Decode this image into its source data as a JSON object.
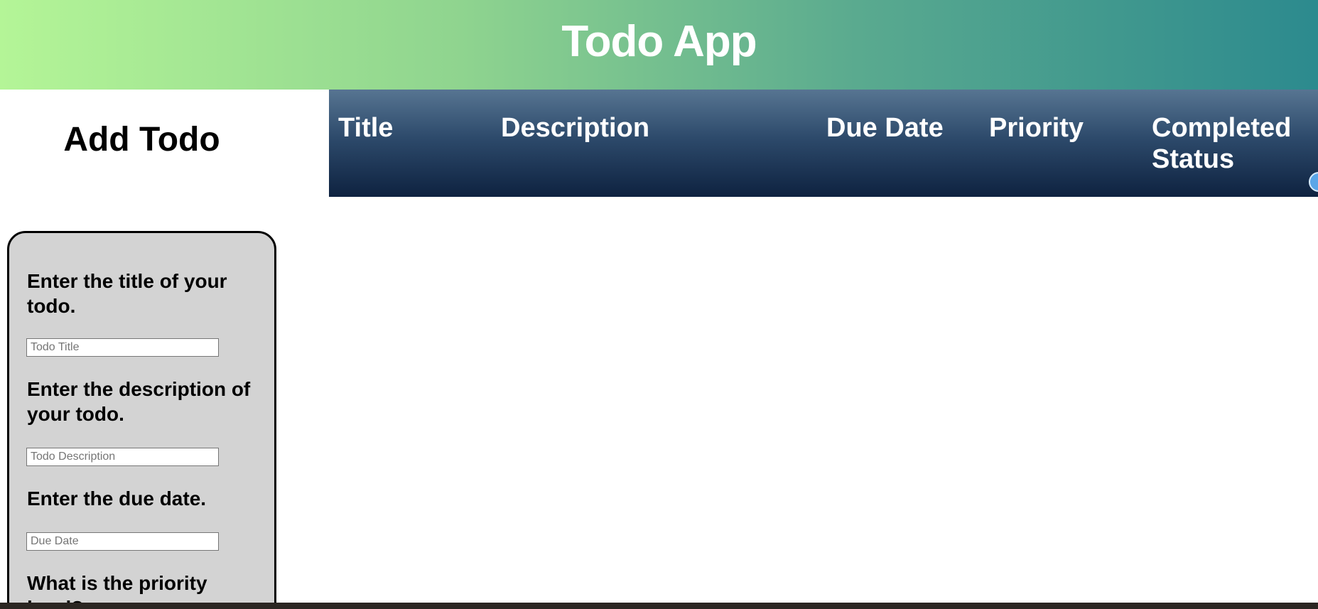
{
  "header": {
    "app_title": "Todo App"
  },
  "add_panel": {
    "heading": "Add Todo"
  },
  "table": {
    "columns": [
      "Title",
      "Description",
      "Due Date",
      "Priority",
      "Completed Status"
    ]
  },
  "form": {
    "title_label": "Enter the title of your todo.",
    "title_placeholder": "Todo Title",
    "description_label": "Enter the description of your todo.",
    "description_placeholder": "Todo Description",
    "due_label": "Enter the due date.",
    "due_placeholder": "Due Date",
    "priority_label": "What is the priority level?"
  },
  "colors": {
    "header_gradient_start": "#b4f597",
    "header_gradient_end": "#2c8a8e",
    "table_header_top": "#577592",
    "table_header_bottom": "#0e2240",
    "form_background": "#d3d3d3"
  }
}
